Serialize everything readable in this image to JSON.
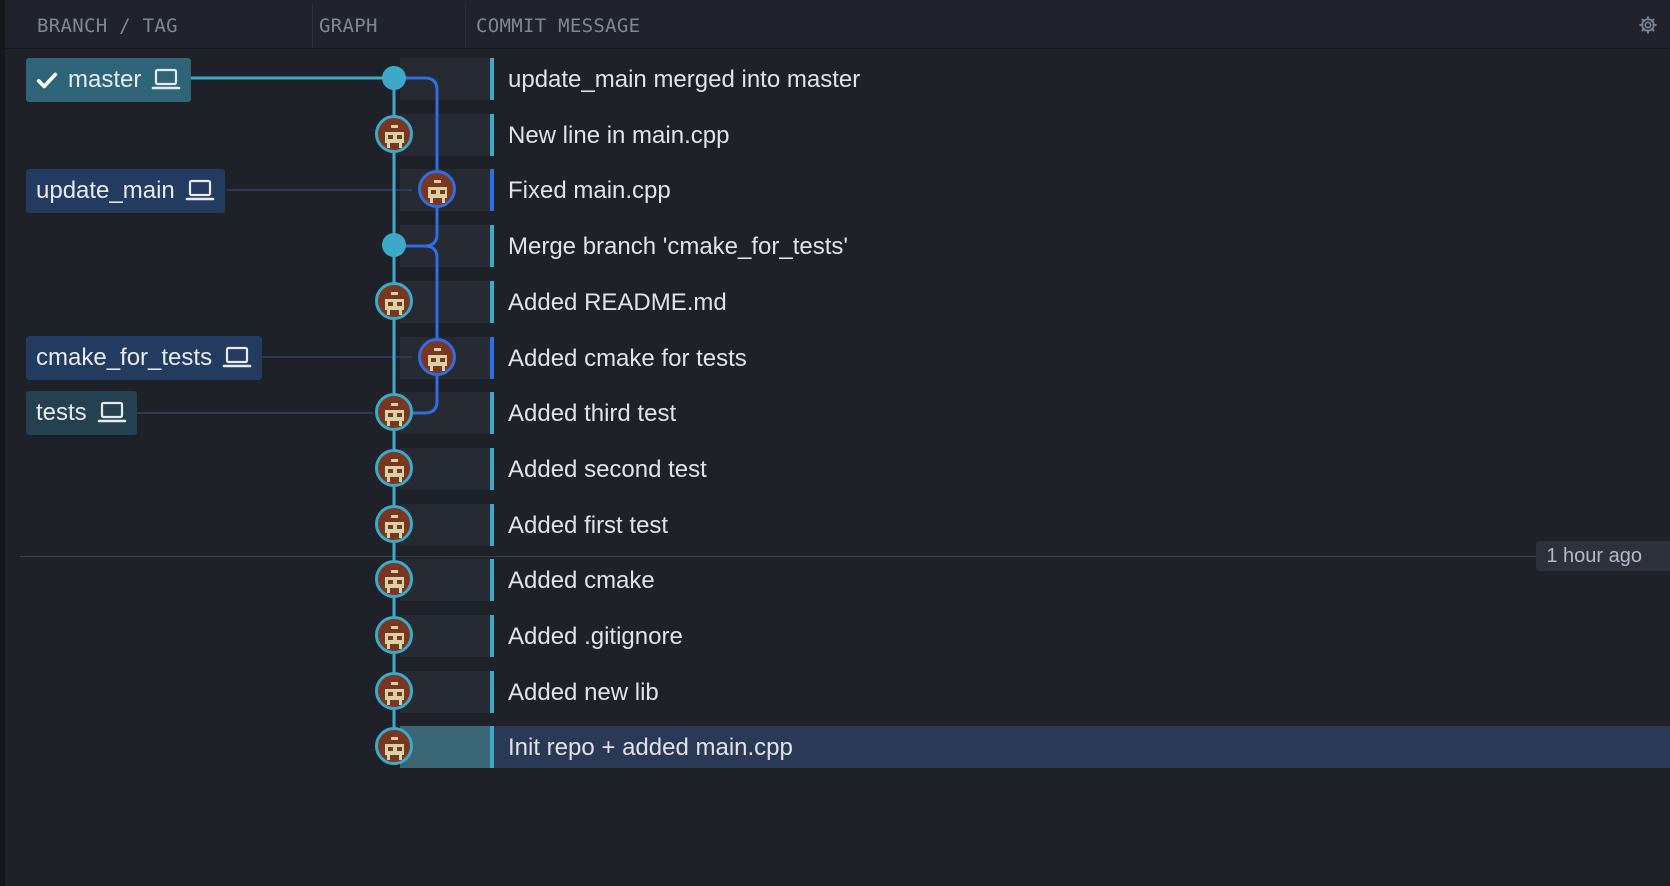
{
  "header": {
    "branch_tag": "BRANCH / TAG",
    "graph": "GRAPH",
    "commit_message": "COMMIT MESSAGE"
  },
  "refs": [
    {
      "name": "master",
      "current": true,
      "local": true
    },
    {
      "name": "update_main",
      "current": false,
      "local": true
    },
    {
      "name": "cmake_for_tests",
      "current": false,
      "local": true
    },
    {
      "name": "tests",
      "current": false,
      "local": true
    }
  ],
  "commits": [
    {
      "message": "update_main merged into master",
      "kind": "merge-dot",
      "lane": 0
    },
    {
      "message": "New line in main.cpp",
      "kind": "avatar",
      "lane": 0
    },
    {
      "message": "Fixed main.cpp",
      "kind": "avatar",
      "lane": 1
    },
    {
      "message": "Merge branch 'cmake_for_tests'",
      "kind": "merge-dot",
      "lane": 0
    },
    {
      "message": "Added README.md",
      "kind": "avatar",
      "lane": 0
    },
    {
      "message": "Added cmake for tests",
      "kind": "avatar",
      "lane": 1
    },
    {
      "message": "Added third test",
      "kind": "avatar",
      "lane": 0
    },
    {
      "message": "Added second test",
      "kind": "avatar",
      "lane": 0
    },
    {
      "message": "Added first test",
      "kind": "avatar",
      "lane": 0
    },
    {
      "message": "Added cmake",
      "kind": "avatar",
      "lane": 0
    },
    {
      "message": "Added .gitignore",
      "kind": "avatar",
      "lane": 0
    },
    {
      "message": "Added new lib",
      "kind": "avatar",
      "lane": 0
    },
    {
      "message": "Init repo + added main.cpp",
      "kind": "avatar",
      "lane": 0,
      "selected": true
    }
  ],
  "time_marker": {
    "label": "1 hour ago"
  },
  "colors": {
    "lane_main": "#3da9c9",
    "lane_branch": "#2f6de0",
    "background": "#1e2128",
    "selected_row": "#2a3a56"
  },
  "icons": [
    "checkmark-icon",
    "laptop-icon",
    "gear-icon"
  ]
}
